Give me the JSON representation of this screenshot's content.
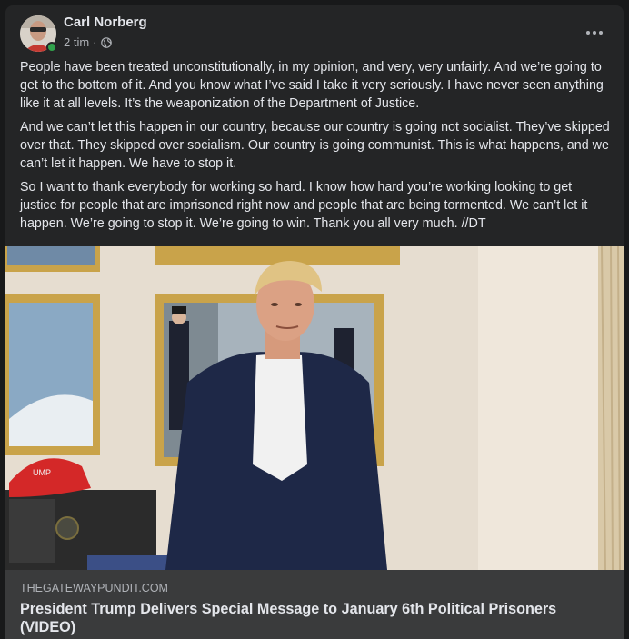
{
  "post": {
    "author": "Carl Norberg",
    "time": "2 tim",
    "separator": "·",
    "paragraphs": [
      "People have been treated unconstitutionally, in my opinion, and very, very unfairly. And we’re going to get to the bottom of it. And you know what I’ve said I take it very seriously. I have never seen anything like it at all levels. It’s the weaponization of the Department of Justice.",
      "And we can’t let this happen in our country, because our country is going not socialist. They’ve skipped over that. They skipped over socialism. Our country is going communist. This is what happens, and we can’t let it happen. We have to stop it.",
      "So I want to thank everybody for working so hard. I know how hard you’re working looking to get justice for people that are imprisoned right now and people that are being tormented. We can’t let it happen. We’re going to stop it. We’re going to win. Thank you all very much. //DT"
    ],
    "icons": {
      "audience": "globe-icon",
      "menu": "more-options-icon"
    }
  },
  "link": {
    "domain": "THEGATEWAYPUNDIT.COM",
    "title": "President Trump Delivers Special Message to January 6th Political Prisoners (VIDEO)"
  },
  "colors": {
    "background": "#18191a",
    "card": "#242526",
    "link_footer": "#3a3b3c",
    "primary_text": "#e4e6eb",
    "secondary_text": "#b0b3b8",
    "online": "#31a24c"
  }
}
